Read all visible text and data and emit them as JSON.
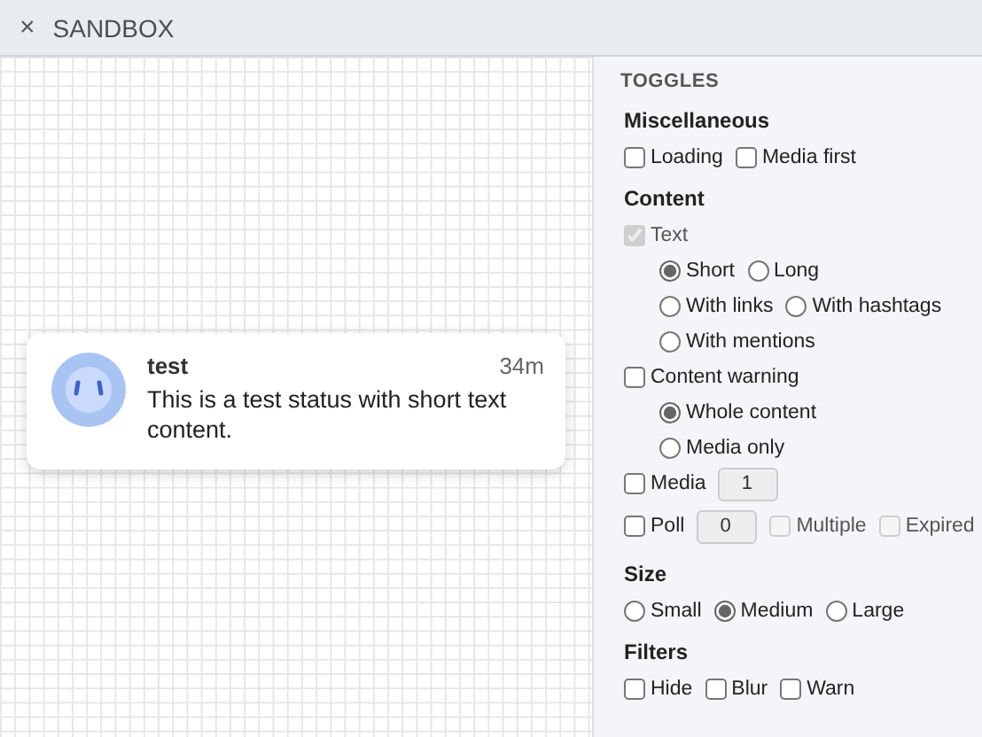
{
  "header": {
    "close": "×",
    "title": "SANDBOX"
  },
  "status": {
    "name": "test",
    "time": "34m",
    "text": "This is a test status with short text content."
  },
  "panel": {
    "title": "TOGGLES",
    "sections": [
      {
        "title": "Miscellaneous",
        "rows": [
          {
            "controls": [
              {
                "kind": "checkbox",
                "label": "Loading",
                "checked": false,
                "disabled": false
              },
              {
                "kind": "checkbox",
                "label": "Media first",
                "checked": false,
                "disabled": false
              }
            ]
          }
        ]
      },
      {
        "title": "Content",
        "rows": [
          {
            "controls": [
              {
                "kind": "checkbox",
                "label": "Text",
                "checked": true,
                "disabled": true
              }
            ],
            "children": [
              {
                "controls": [
                  {
                    "kind": "radio",
                    "label": "Short",
                    "selected": true
                  },
                  {
                    "kind": "radio",
                    "label": "Long",
                    "selected": false
                  }
                ]
              },
              {
                "controls": [
                  {
                    "kind": "radio",
                    "label": "With links",
                    "selected": false
                  },
                  {
                    "kind": "radio",
                    "label": "With hashtags",
                    "selected": false
                  }
                ]
              },
              {
                "controls": [
                  {
                    "kind": "radio",
                    "label": "With mentions",
                    "selected": false
                  }
                ]
              }
            ]
          },
          {
            "controls": [
              {
                "kind": "checkbox",
                "label": "Content warning",
                "checked": false,
                "disabled": false
              }
            ],
            "children": [
              {
                "controls": [
                  {
                    "kind": "radio",
                    "label": "Whole content",
                    "selected": true
                  }
                ]
              },
              {
                "controls": [
                  {
                    "kind": "radio",
                    "label": "Media only",
                    "selected": false
                  }
                ]
              }
            ]
          },
          {
            "controls": [
              {
                "kind": "checkbox",
                "label": "Media",
                "checked": false,
                "disabled": false
              },
              {
                "kind": "number",
                "value": "1"
              }
            ]
          },
          {
            "controls": [
              {
                "kind": "checkbox",
                "label": "Poll",
                "checked": false,
                "disabled": false
              },
              {
                "kind": "number",
                "value": "0"
              },
              {
                "kind": "checkbox",
                "label": "Multiple",
                "checked": false,
                "disabled": true
              },
              {
                "kind": "checkbox",
                "label": "Expired",
                "checked": false,
                "disabled": true
              }
            ]
          }
        ]
      },
      {
        "title": "Size",
        "rows": [
          {
            "controls": [
              {
                "kind": "radio",
                "label": "Small",
                "selected": false
              },
              {
                "kind": "radio",
                "label": "Medium",
                "selected": true
              },
              {
                "kind": "radio",
                "label": "Large",
                "selected": false
              }
            ]
          }
        ]
      },
      {
        "title": "Filters",
        "rows": [
          {
            "controls": [
              {
                "kind": "checkbox",
                "label": "Hide",
                "checked": false,
                "disabled": false
              },
              {
                "kind": "checkbox",
                "label": "Blur",
                "checked": false,
                "disabled": false
              },
              {
                "kind": "checkbox",
                "label": "Warn",
                "checked": false,
                "disabled": false
              }
            ]
          }
        ]
      }
    ]
  }
}
